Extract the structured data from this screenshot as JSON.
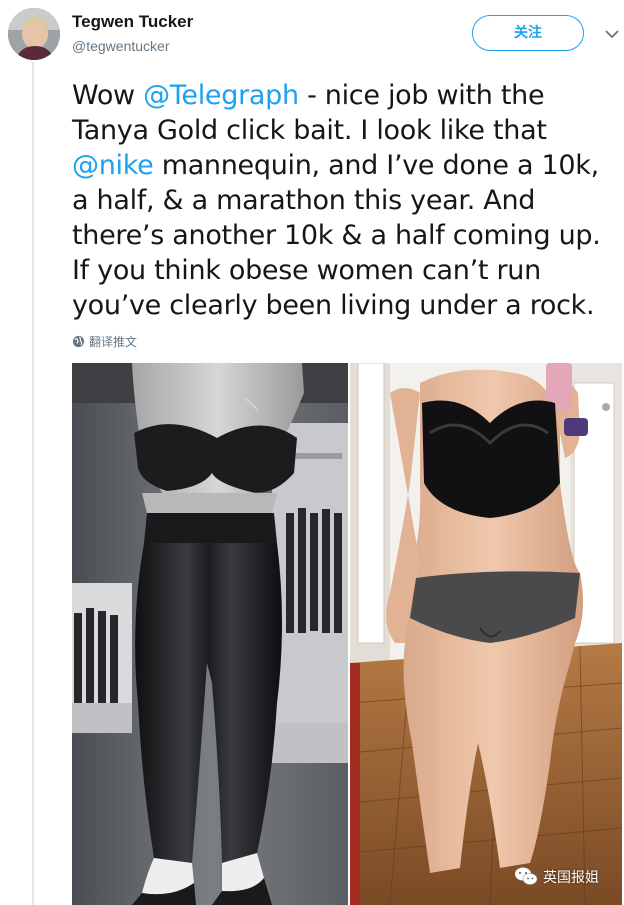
{
  "tweet": {
    "author": {
      "name": "Tegwen Tucker",
      "handle": "@tegwentucker"
    },
    "follow_label": "关注",
    "text_segments": [
      {
        "type": "text",
        "value": "Wow "
      },
      {
        "type": "mention",
        "value": "@Telegraph"
      },
      {
        "type": "text",
        "value": " - nice job with the Tanya Gold click bait. I look like that "
      },
      {
        "type": "mention",
        "value": "@nike"
      },
      {
        "type": "text",
        "value": " mannequin, and I’ve done a 10k, a half, & a marathon this year. And there’s another 10k & a half coming up. If you think obese women can’t run you’ve clearly been living under a rock."
      }
    ],
    "translate_label": "翻译推文",
    "media": [
      {
        "name": "mannequin-photo"
      },
      {
        "name": "mirror-selfie-photo"
      }
    ]
  },
  "watermark": {
    "label": "英国报姐",
    "icon": "wechat-icon"
  },
  "colors": {
    "link": "#1da1f2",
    "text": "#14171a",
    "secondary": "#657786",
    "divider": "#e1e8ed"
  }
}
